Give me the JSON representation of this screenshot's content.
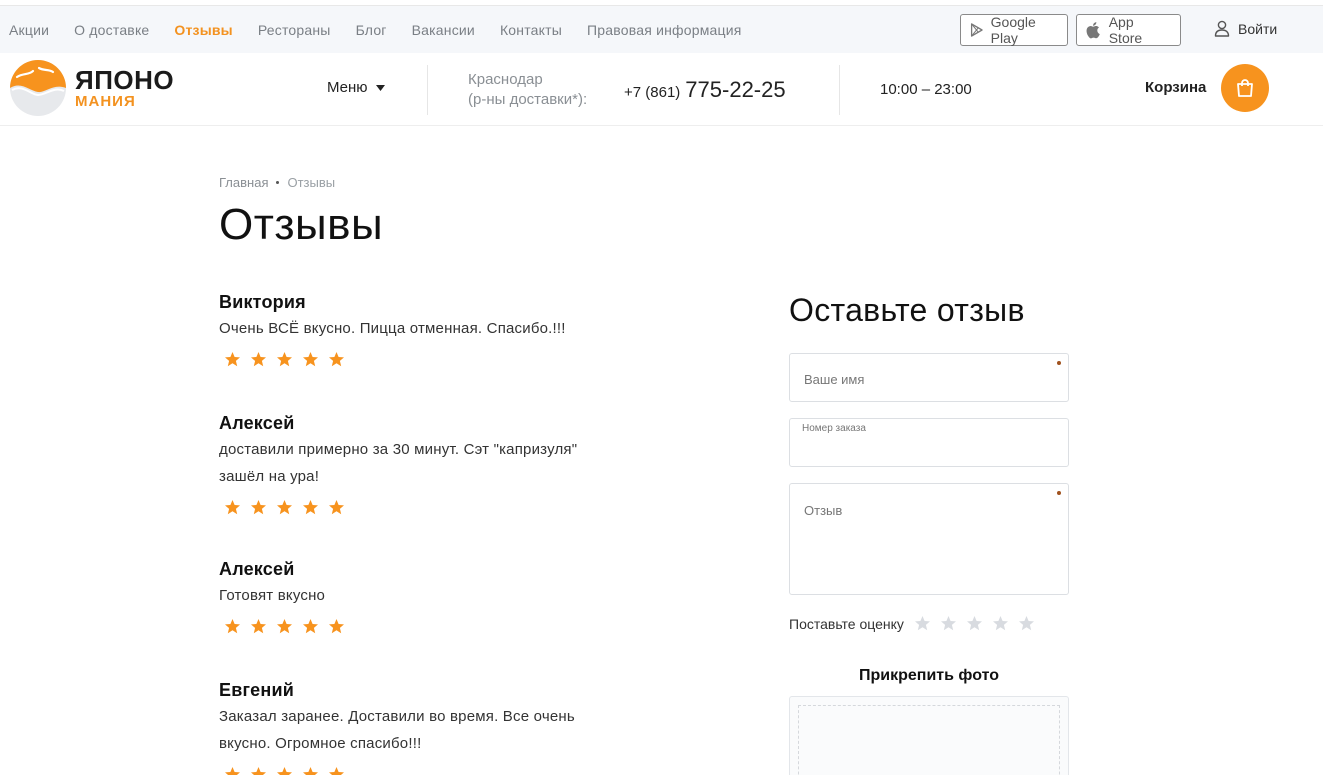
{
  "topbar": {
    "nav": [
      "Акции",
      "О доставке",
      "Отзывы",
      "Рестораны",
      "Блог",
      "Вакансии",
      "Контакты",
      "Правовая информация"
    ],
    "active_index": 2,
    "google_play": "Google Play",
    "app_store": "App Store",
    "login": "Войти"
  },
  "header": {
    "logo_line1": "ЯПОНО",
    "logo_line2": "МАНИЯ",
    "menu": "Меню",
    "city_line1": "Краснодар",
    "city_line2": "(р-ны доставки*):",
    "phone_code": "+7 (861)",
    "phone_number": "775-22-25",
    "hours": "10:00 – 23:00",
    "cart": "Корзина"
  },
  "breadcrumb": {
    "home": "Главная",
    "current": "Отзывы"
  },
  "page_title": "Отзывы",
  "reviews": [
    {
      "name": "Виктория",
      "text": "Очень ВСЁ вкусно. Пицца отменная. Спасибо.!!!",
      "rating": 5
    },
    {
      "name": "Алексей",
      "text": "доставили примерно за 30 минут. Сэт \"капризуля\" зашёл на ура!",
      "rating": 5
    },
    {
      "name": "Алексей",
      "text": "Готовят вкусно",
      "rating": 5
    },
    {
      "name": "Евгений",
      "text": "Заказал заранее. Доставили во время. Все очень вкусно. Огромное спасибо!!!",
      "rating": 5
    }
  ],
  "form": {
    "title": "Оставьте отзыв",
    "name_placeholder": "Ваше имя",
    "order_placeholder": "Номер заказа",
    "review_placeholder": "Отзыв",
    "rating_label": "Поставьте оценку",
    "attach_title": "Прикрепить фото"
  },
  "colors": {
    "accent": "#f39220",
    "star_active": "#f7931e",
    "star_inactive": "#d8dbe0"
  }
}
